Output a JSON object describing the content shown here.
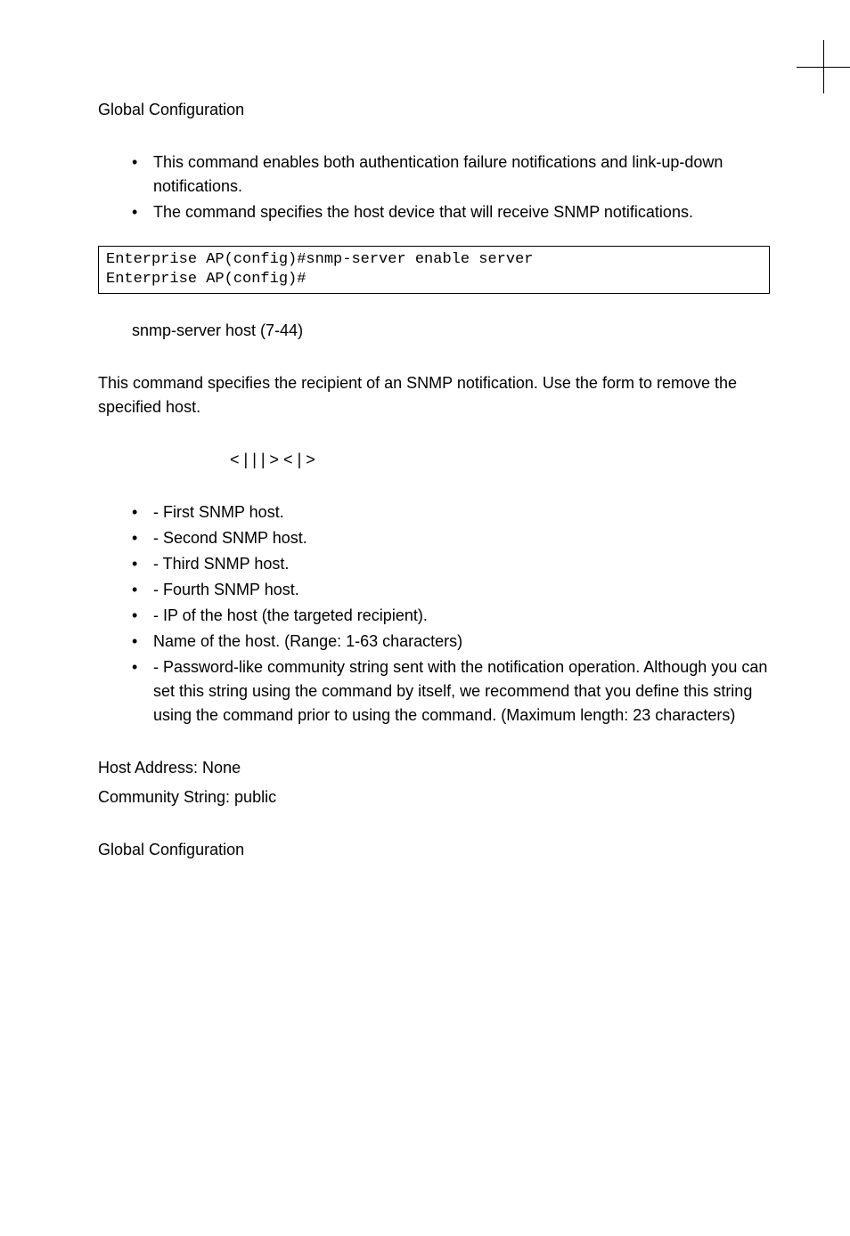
{
  "command_mode_1": {
    "label": "Global Configuration"
  },
  "bullets_1": {
    "item1": "This command enables both authentication failure notifications and link-up-down notifications.",
    "item2_pre": "The ",
    "item2_post": "command specifies the host device that will receive SNMP notifications."
  },
  "code_block": "Enterprise AP(config)#snmp-server enable server\nEnterprise AP(config)#",
  "related": {
    "text": "snmp-server host (7-44)"
  },
  "desc": {
    "text_pre": "This command specifies the recipient of an SNMP notification. Use the ",
    "text_post": "form to remove the specified host."
  },
  "syntax": {
    "line": "< | | | > < | >"
  },
  "params": {
    "p1": " - First SNMP host.",
    "p2": " - Second SNMP host.",
    "p3": " - Third SNMP host.",
    "p4": " - Fourth SNMP host.",
    "p5": " - IP of the host (the targeted recipient).",
    "p6": "Name of the host. (Range: 1-63 characters)",
    "p7_a": " - Password-like community string sent with the notification operation. Although you can set this string using the ",
    "p7_b": "command by itself, we recommend that you define this string using the ",
    "p7_c": "command prior to using the ",
    "p7_d": "command. (Maximum length: 23 characters)"
  },
  "default": {
    "host": "Host Address: None",
    "comm": "Community String: public"
  },
  "command_mode_2": {
    "label": "Global Configuration"
  }
}
